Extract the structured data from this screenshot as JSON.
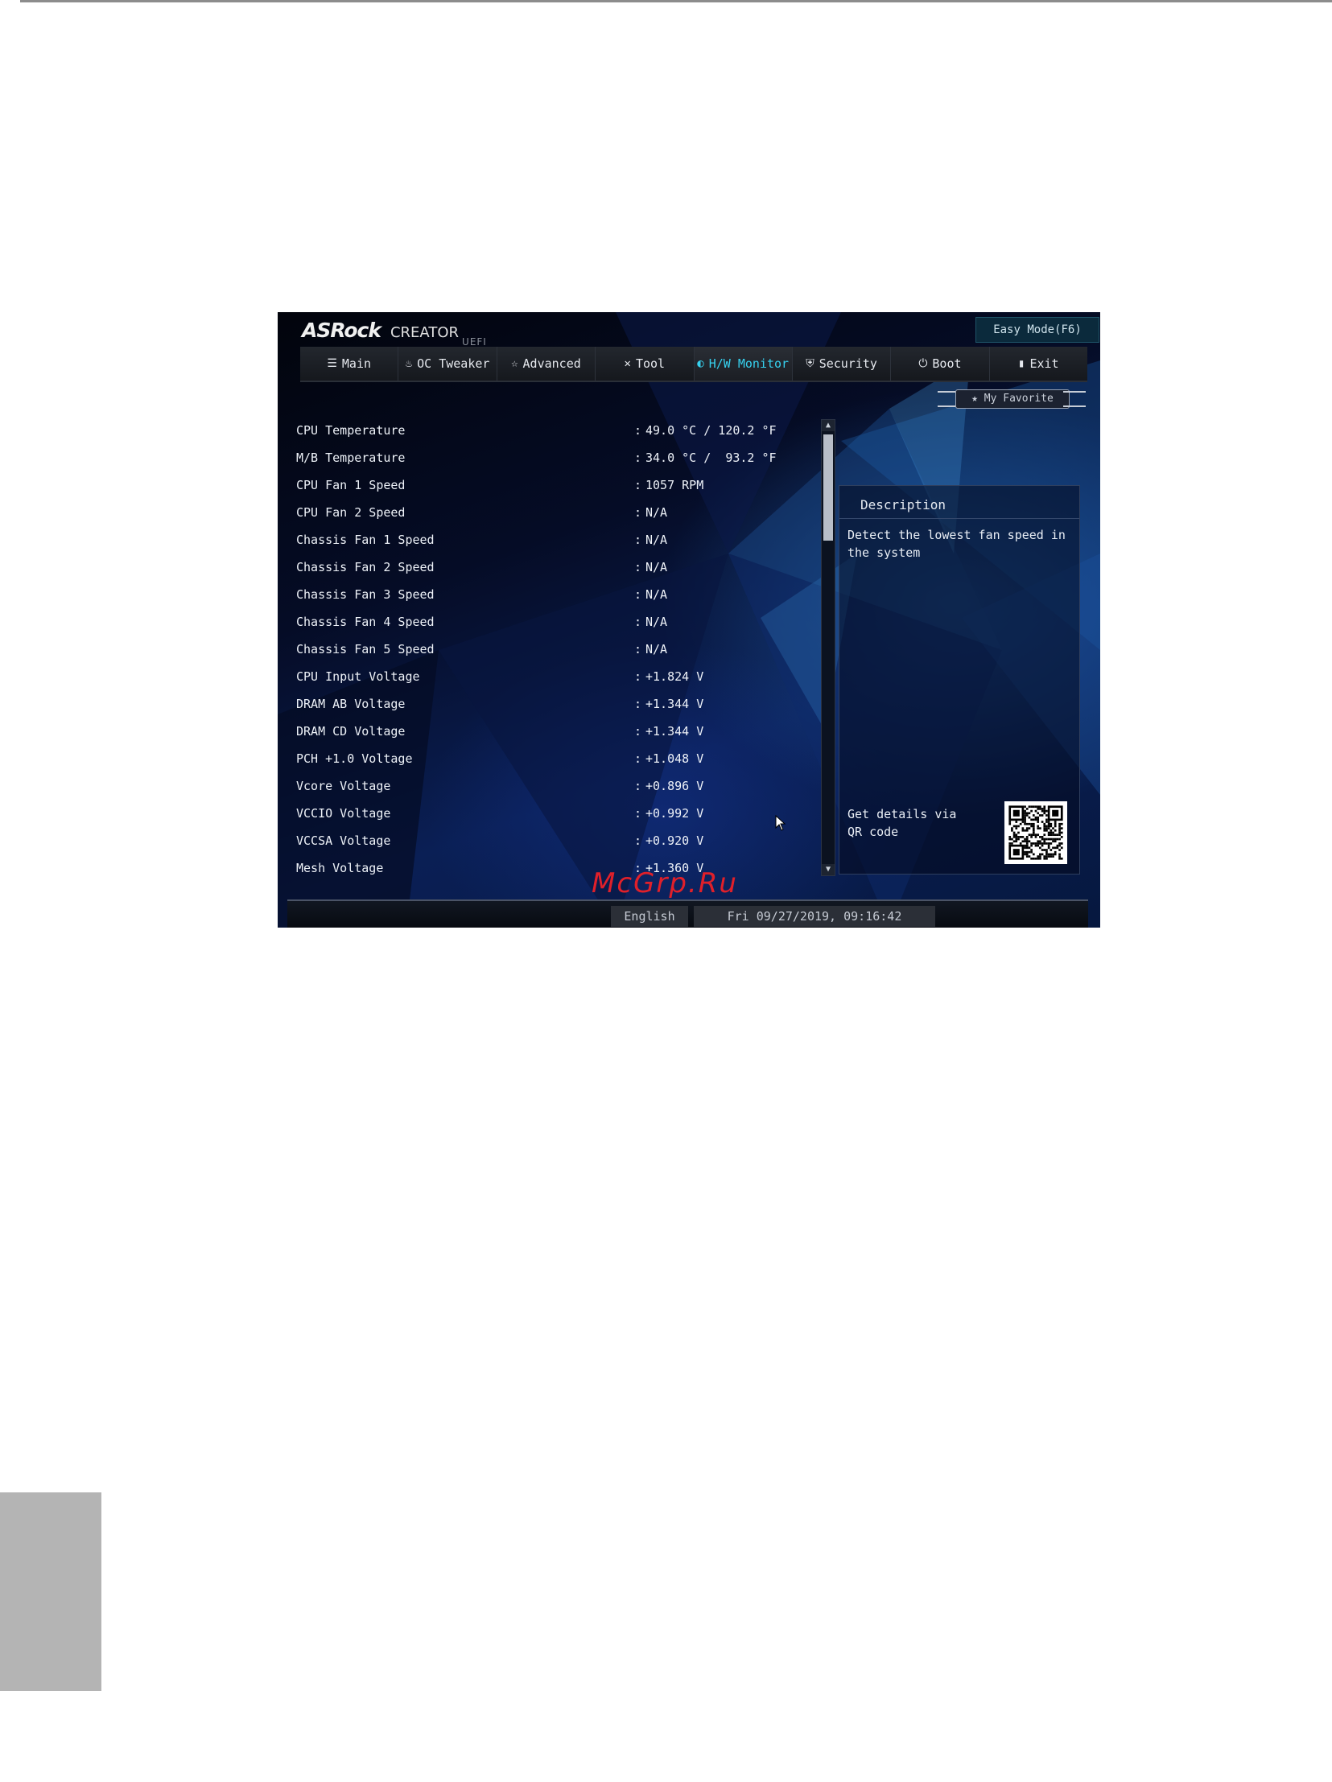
{
  "header": {
    "brand_logo": "ASRock",
    "brand_name": "CREATOR",
    "brand_sub": "UEFI",
    "easy_mode": "Easy Mode(F6)"
  },
  "tabs": [
    {
      "label": "Main",
      "icon": "list-icon",
      "glyph": "☰",
      "active": false
    },
    {
      "label": "OC Tweaker",
      "icon": "flame-icon",
      "glyph": "♨",
      "active": false
    },
    {
      "label": "Advanced",
      "icon": "star-icon",
      "glyph": "☆",
      "active": false
    },
    {
      "label": "Tool",
      "icon": "tools-icon",
      "glyph": "✕",
      "active": false
    },
    {
      "label": "H/W Monitor",
      "icon": "monitor-icon",
      "glyph": "◐",
      "active": true
    },
    {
      "label": "Security",
      "icon": "shield-icon",
      "glyph": "⛨",
      "active": false
    },
    {
      "label": "Boot",
      "icon": "power-icon",
      "glyph": "⏻",
      "active": false
    },
    {
      "label": "Exit",
      "icon": "exit-icon",
      "glyph": "▮",
      "active": false
    }
  ],
  "favorite": {
    "label": "My Favorite",
    "icon": "star-icon"
  },
  "rows": [
    {
      "label": "CPU Temperature",
      "colon": ":",
      "value": "49.0 °C / 120.2 °F"
    },
    {
      "label": "M/B Temperature",
      "colon": ":",
      "value": "34.0 °C /  93.2 °F"
    },
    {
      "label": "CPU Fan 1 Speed",
      "colon": ":",
      "value": "1057 RPM"
    },
    {
      "label": "CPU Fan 2 Speed",
      "colon": ":",
      "value": "N/A"
    },
    {
      "label": "Chassis Fan 1 Speed",
      "colon": ":",
      "value": "N/A"
    },
    {
      "label": "Chassis Fan 2 Speed",
      "colon": ":",
      "value": "N/A"
    },
    {
      "label": "Chassis Fan 3 Speed",
      "colon": ":",
      "value": "N/A"
    },
    {
      "label": "Chassis Fan 4 Speed",
      "colon": ":",
      "value": "N/A"
    },
    {
      "label": "Chassis Fan 5 Speed",
      "colon": ":",
      "value": "N/A"
    },
    {
      "label": "CPU Input Voltage",
      "colon": ":",
      "value": "+1.824 V"
    },
    {
      "label": "DRAM AB Voltage",
      "colon": ":",
      "value": "+1.344 V"
    },
    {
      "label": "DRAM CD Voltage",
      "colon": ":",
      "value": "+1.344 V"
    },
    {
      "label": "PCH +1.0 Voltage",
      "colon": ":",
      "value": "+1.048 V"
    },
    {
      "label": "Vcore Voltage",
      "colon": ":",
      "value": "+0.896 V"
    },
    {
      "label": "VCCIO Voltage",
      "colon": ":",
      "value": "+0.992 V"
    },
    {
      "label": "VCCSA Voltage",
      "colon": ":",
      "value": "+0.920 V"
    },
    {
      "label": "Mesh Voltage",
      "colon": ":",
      "value": "+1.360 V"
    }
  ],
  "description": {
    "title": "Description",
    "text": "Detect the lowest fan speed in the system",
    "qr_text": "Get details via QR code"
  },
  "footer": {
    "language": "English",
    "datetime": "Fri 09/27/2019, 09:16:42"
  },
  "watermark": "McGrp.Ru",
  "colors": {
    "accent": "#36d0ee",
    "watermark": "#e0202a"
  }
}
